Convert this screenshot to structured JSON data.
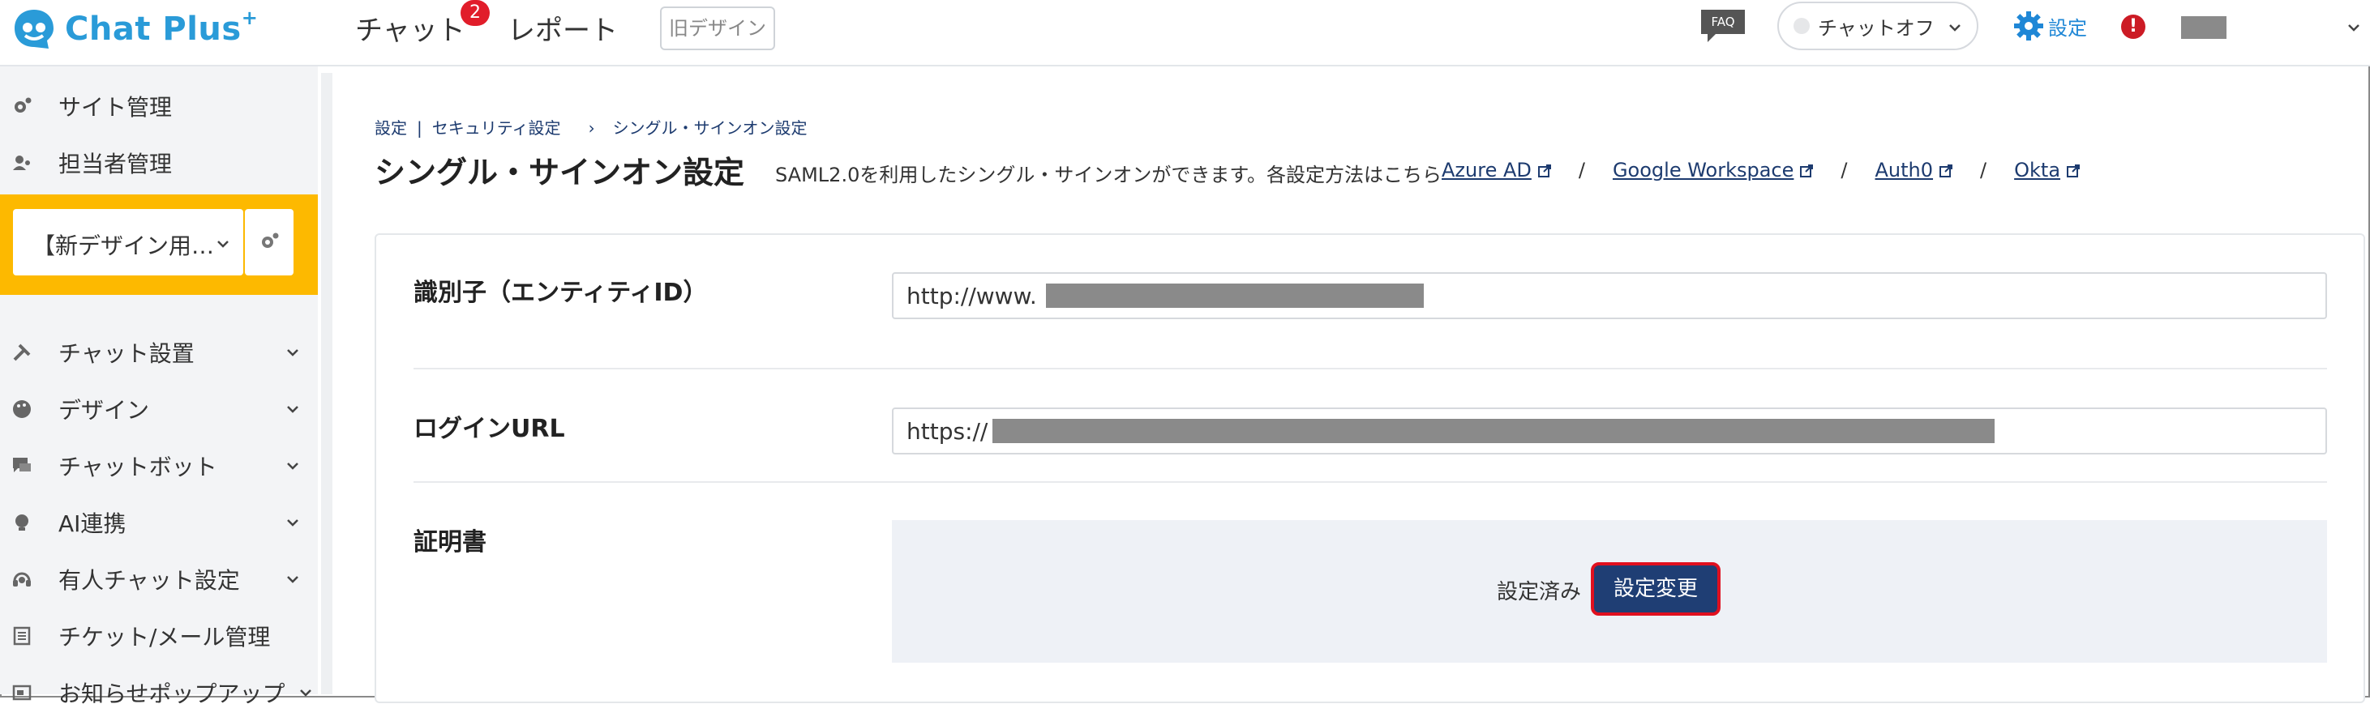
{
  "header": {
    "logo_text": "Chat Plus",
    "logo_plus": "+",
    "nav_chat": "チャット",
    "chat_badge": "2",
    "nav_report": "レポート",
    "old_design": "旧デザイン",
    "faq": "FAQ",
    "chat_status": "チャットオフ",
    "settings": "設定",
    "alert": "!"
  },
  "sidebar": {
    "top_items": [
      {
        "label": "サイト管理",
        "icon": "gear-icon"
      },
      {
        "label": "担当者管理",
        "icon": "users-icon"
      }
    ],
    "site_select": "【新デザイン用…",
    "menu": [
      {
        "label": "チャット設置",
        "icon": "tools-icon"
      },
      {
        "label": "デザイン",
        "icon": "palette-icon"
      },
      {
        "label": "チャットボット",
        "icon": "chat-bubble-icon"
      },
      {
        "label": "AI連携",
        "icon": "bulb-icon"
      },
      {
        "label": "有人チャット設定",
        "icon": "headset-icon"
      },
      {
        "label": "チケット/メール管理",
        "icon": "list-icon"
      },
      {
        "label": "お知らせポップアップ",
        "icon": "popup-icon"
      }
    ]
  },
  "breadcrumb": {
    "root": "設定",
    "sep": "|",
    "parent": "セキュリティ設定",
    "arrow": "›",
    "current": "シングル・サインオン設定"
  },
  "page": {
    "title": "シングル・サインオン設定",
    "description": "SAML2.0を利用したシングル・サインオンができます。各設定方法はこちら",
    "links": [
      "Azure AD",
      "Google Workspace",
      "Auth0",
      "Okta"
    ],
    "link_sep": "/"
  },
  "form": {
    "entity_id_label": "識別子（エンティティID）",
    "entity_id_value": "http://www.",
    "login_url_label": "ログインURL",
    "login_url_value": "https://",
    "cert_label": "証明書",
    "cert_status": "設定済み",
    "cert_button": "設定変更"
  },
  "colors": {
    "brand": "#2a9bd8",
    "sidebar_highlight": "#fdb900",
    "button": "#1f3e74",
    "highlight_border": "#e0101f"
  }
}
